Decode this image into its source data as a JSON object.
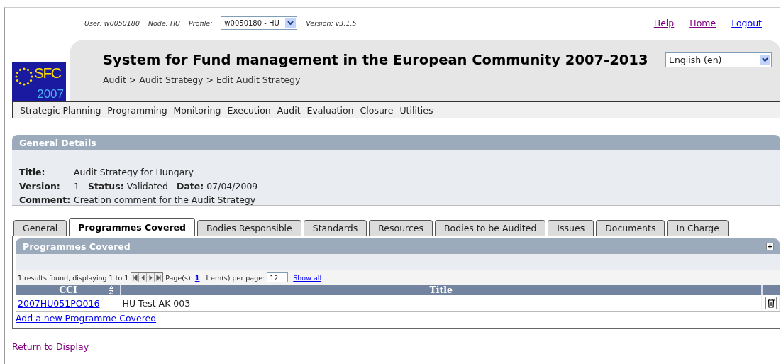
{
  "session": [
    {
      "label": "User:",
      "value": "w0050180"
    },
    {
      "label": "Node:",
      "value": "HU"
    }
  ],
  "profile": {
    "label": "Profile:",
    "value": "w0050180 - HU"
  },
  "version": {
    "label": "Version:",
    "value": "v3.1.5"
  },
  "top_links": [
    "Help",
    "Home",
    "Logout"
  ],
  "logo": {
    "text": "SFC",
    "year": "2007"
  },
  "title": "System for Fund management in the European Community 2007-2013",
  "breadcrumb": "Audit > Audit Strategy > Edit Audit Strategy",
  "language": "English (en)",
  "menu": [
    "Strategic Planning",
    "Programming",
    "Monitoring",
    "Execution",
    "Audit",
    "Evaluation",
    "Closure",
    "Utilities"
  ],
  "general_details": {
    "heading": "General Details",
    "title_label": "Title:",
    "title": "Audit Strategy for Hungary",
    "version_label": "Version:",
    "version": "1",
    "status_label": "Status:",
    "status": "Validated",
    "date_label": "Date:",
    "date": "07/04/2009",
    "comment_label": "Comment:",
    "comment": "Creation comment for the Audit Strategy"
  },
  "tabs": [
    {
      "label": "General",
      "selected": false
    },
    {
      "label": "Programmes Covered",
      "selected": true
    },
    {
      "label": "Bodies Responsible",
      "selected": false
    },
    {
      "label": "Standards",
      "selected": false
    },
    {
      "label": "Resources",
      "selected": false
    },
    {
      "label": "Bodies to be Audited",
      "selected": false
    },
    {
      "label": "Issues",
      "selected": false
    },
    {
      "label": "Documents",
      "selected": false
    },
    {
      "label": "In Charge",
      "selected": false
    }
  ],
  "panel": {
    "heading": "Programmes Covered",
    "pager": {
      "summary": "1 results found, displaying 1 to 1",
      "pages_label": "Page(s):",
      "page": "1",
      "per_page_label": ". Item(s) per page:",
      "per_page": "12",
      "show_all": "Show all"
    },
    "table": {
      "columns": [
        "CCI",
        "Title"
      ],
      "rows": [
        {
          "cci": "2007HU051PO016",
          "title": "HU Test AK 003"
        }
      ]
    },
    "add_link": "Add a new Programme Covered"
  },
  "return_link": "Return to Display"
}
